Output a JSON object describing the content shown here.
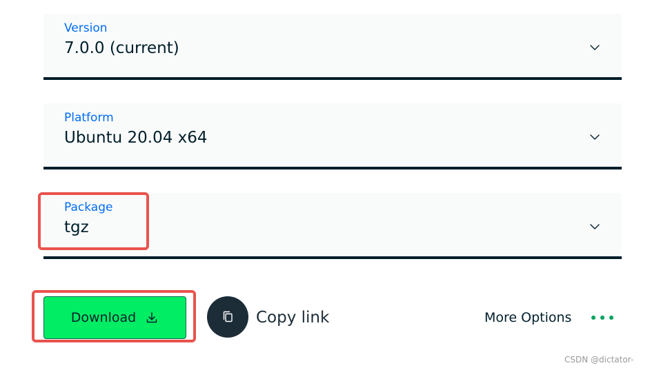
{
  "fields": {
    "version": {
      "label": "Version",
      "value": "7.0.0 (current)"
    },
    "platform": {
      "label": "Platform",
      "value": "Ubuntu 20.04 x64"
    },
    "package": {
      "label": "Package",
      "value": "tgz"
    }
  },
  "actions": {
    "download_label": "Download",
    "copy_label": "Copy link",
    "more_options_label": "More Options"
  },
  "icons": {
    "chevron": "chevron-down-icon",
    "download": "download-icon",
    "copy": "copy-icon",
    "more": "ellipsis-icon"
  },
  "colors": {
    "label_blue": "#016bf8",
    "dark_text": "#001e2b",
    "download_green": "#00ed64",
    "highlight_red": "#e8534d",
    "field_bg": "#f9fbfa",
    "dots_green": "#00a35c"
  },
  "watermark": "CSDN @dictator-"
}
